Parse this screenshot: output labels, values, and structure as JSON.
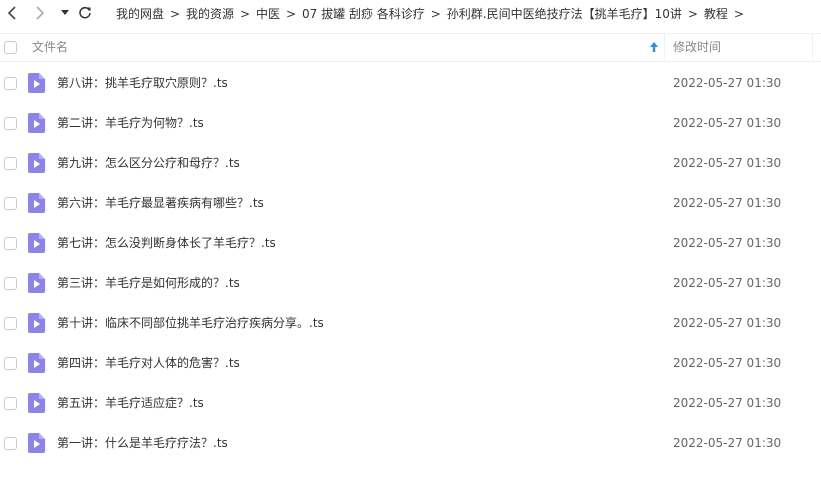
{
  "breadcrumbs": [
    "我的网盘",
    "我的资源",
    "中医",
    "07 拔罐 刮痧 各科诊疗",
    "孙利群.民间中医绝技疗法【挑羊毛疗】10讲",
    "教程"
  ],
  "breadcrumb_separator": ">",
  "header": {
    "name_label": "文件名",
    "time_label": "修改时间"
  },
  "files": [
    {
      "name": "第八讲：挑羊毛疗取穴原则？.ts",
      "time": "2022-05-27 01:30"
    },
    {
      "name": "第二讲：羊毛疗为何物？.ts",
      "time": "2022-05-27 01:30"
    },
    {
      "name": "第九讲：怎么区分公疗和母疗？.ts",
      "time": "2022-05-27 01:30"
    },
    {
      "name": "第六讲：羊毛疗最显著疾病有哪些？.ts",
      "time": "2022-05-27 01:30"
    },
    {
      "name": "第七讲：怎么没判断身体长了羊毛疗？.ts",
      "time": "2022-05-27 01:30"
    },
    {
      "name": "第三讲：羊毛疗是如何形成的？.ts",
      "time": "2022-05-27 01:30"
    },
    {
      "name": "第十讲：临床不同部位挑羊毛疗治疗疾病分享。.ts",
      "time": "2022-05-27 01:30"
    },
    {
      "name": "第四讲：羊毛疗对人体的危害？.ts",
      "time": "2022-05-27 01:30"
    },
    {
      "name": "第五讲：羊毛疗适应症？.ts",
      "time": "2022-05-27 01:30"
    },
    {
      "name": "第一讲：什么是羊毛疗疗法？.ts",
      "time": "2022-05-27 01:30"
    }
  ],
  "colors": {
    "video_icon": "#8c84e8",
    "video_icon_fold": "#b7b1f2",
    "sort_arrow": "#2f8cf0"
  },
  "icons": {
    "back": "chevron-left-icon",
    "forward": "chevron-right-icon",
    "history": "caret-down-icon",
    "refresh": "refresh-icon",
    "sort": "sort-ascending-icon",
    "file": "video-file-icon"
  }
}
